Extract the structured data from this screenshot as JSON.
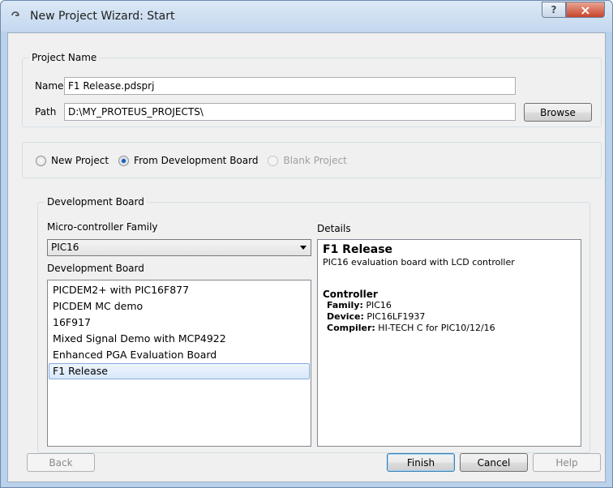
{
  "window": {
    "title": "New Project Wizard: Start",
    "help_label": "?",
    "close_label": "×"
  },
  "project_name": {
    "legend": "Project Name",
    "name_label": "Name",
    "name_value": "F1 Release.pdsprj",
    "path_label": "Path",
    "path_value": "D:\\MY_PROTEUS_PROJECTS\\",
    "browse_label": "Browse"
  },
  "project_type": {
    "options": [
      {
        "label": "New Project",
        "checked": false,
        "enabled": true
      },
      {
        "label": "From Development Board",
        "checked": true,
        "enabled": true
      },
      {
        "label": "Blank Project",
        "checked": false,
        "enabled": false
      }
    ]
  },
  "dev_board": {
    "legend": "Development Board",
    "family_label": "Micro-controller Family",
    "family_value": "PIC16",
    "board_label": "Development Board",
    "boards": [
      "PICDEM2+ with PIC16F877",
      "PICDEM MC demo",
      "16F917",
      "Mixed Signal Demo with MCP4922",
      "Enhanced PGA Evaluation Board",
      "F1 Release"
    ],
    "selected_board": "F1 Release",
    "details_label": "Details",
    "details": {
      "title": "F1 Release",
      "description": "PIC16 evaluation board with LCD controller",
      "controller_heading": "Controller",
      "family_key": "Family:",
      "family_val": "PIC16",
      "device_key": "Device:",
      "device_val": "PIC16LF1937",
      "compiler_key": "Compiler:",
      "compiler_val": "HI-TECH C for PIC10/12/16"
    }
  },
  "buttons": {
    "back": "Back",
    "finish": "Finish",
    "cancel": "Cancel",
    "help": "Help"
  },
  "colors": {
    "accent": "#1a5fb4",
    "titlebar": "#c4d8ee",
    "close": "#c7452c"
  }
}
